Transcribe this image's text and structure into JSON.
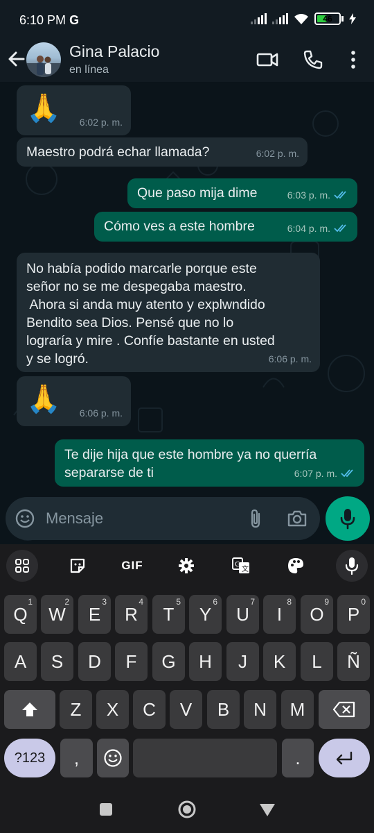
{
  "status_bar": {
    "time": "6:10 PM",
    "carrier_glyph": "G",
    "battery": "46",
    "battery_level_percent": 46
  },
  "header": {
    "contact_name": "Gina Palacio",
    "contact_status": "en línea",
    "icons": [
      "back-arrow-icon",
      "video-call-icon",
      "phone-icon",
      "more-options-icon"
    ]
  },
  "messages": [
    {
      "direction": "in",
      "text": "🙏",
      "time": "6:02 p. m."
    },
    {
      "direction": "in",
      "text": "Maestro  podrá echar llamada?",
      "time": "6:02 p. m."
    },
    {
      "direction": "out",
      "text": "Que paso mija dime",
      "time": "6:03 p. m."
    },
    {
      "direction": "out",
      "text": "Cómo ves a este hombre",
      "time": "6:04 p. m."
    },
    {
      "direction": "in",
      "lines": [
        "No había podido marcarle porque  este",
        "señor no se me despegaba maestro.",
        " Ahora si anda muy atento y explwndido",
        "Bendito sea Dios. Pensé que no lo",
        "lograría y mire . Confíe bastante en usted",
        "y se logró."
      ],
      "time": "6:06 p. m."
    },
    {
      "direction": "in",
      "text": "🙏",
      "time": "6:06 p. m."
    },
    {
      "direction": "out",
      "lines": [
        "Te dije hija que este hombre ya no querría",
        "separarse de ti"
      ],
      "time": "6:07 p. m."
    }
  ],
  "input": {
    "placeholder": "Mensaje"
  },
  "keyboard": {
    "toolbar": [
      "apps-grid-icon",
      "sticker-icon",
      "GIF",
      "settings-gear-icon",
      "translate-icon",
      "palette-icon",
      "voice-input-icon"
    ],
    "gif_label": "GIF",
    "row1": [
      {
        "key": "Q",
        "hint": "1"
      },
      {
        "key": "W",
        "hint": "2"
      },
      {
        "key": "E",
        "hint": "3"
      },
      {
        "key": "R",
        "hint": "4"
      },
      {
        "key": "T",
        "hint": "5"
      },
      {
        "key": "Y",
        "hint": "6"
      },
      {
        "key": "U",
        "hint": "7"
      },
      {
        "key": "I",
        "hint": "8"
      },
      {
        "key": "O",
        "hint": "9"
      },
      {
        "key": "P",
        "hint": "0"
      }
    ],
    "row2": [
      "A",
      "S",
      "D",
      "F",
      "G",
      "H",
      "J",
      "K",
      "L",
      "Ñ"
    ],
    "row3": [
      "Z",
      "X",
      "C",
      "V",
      "B",
      "N",
      "M"
    ],
    "symbols_label": "?123",
    "comma": ",",
    "period": "."
  },
  "nav_bar": {
    "icons": [
      "recents-square-icon",
      "home-circle-icon",
      "back-triangle-icon"
    ]
  }
}
